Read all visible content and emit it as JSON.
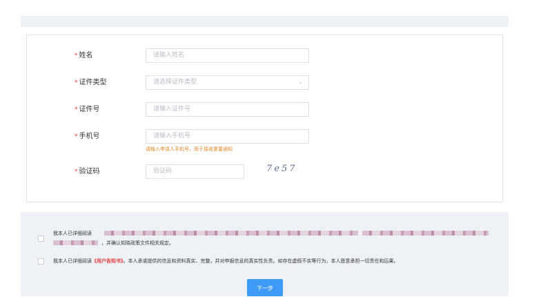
{
  "form": {
    "name": {
      "label": "姓名",
      "placeholder": "请输入姓名"
    },
    "id_type": {
      "label": "证件类型",
      "placeholder": "请选择证件类型",
      "arrow_icon": "chevron-down-icon"
    },
    "id_number": {
      "label": "证件号",
      "placeholder": "请输入证件号"
    },
    "phone": {
      "label": "手机号",
      "placeholder": "请输入手机号",
      "hint": "请输入申请人手机号，用于接收重要通知"
    },
    "captcha": {
      "label": "验证码",
      "placeholder": "验证码",
      "image_text": "7e57"
    },
    "required_mark": "*"
  },
  "agreements": {
    "first_prefix": "我本人已详细阅读",
    "first_suffix": "，并确认知晓政策文件相关规定。",
    "second_prefix": "我本人已详细阅读",
    "second_link": "《用户告知书》",
    "second_suffix": "。本人承诺提供的信息和资料真实、完整，并对申报信息的真实性负责。如存在虚假不实等行为，本人愿意承担一切责任和后果。"
  },
  "next_button": {
    "label": "下一步"
  },
  "colors": {
    "accent": "#3e9bf5",
    "required": "#e63b3b",
    "hint": "#e6892a",
    "panel_bg": "#eef1f6"
  }
}
